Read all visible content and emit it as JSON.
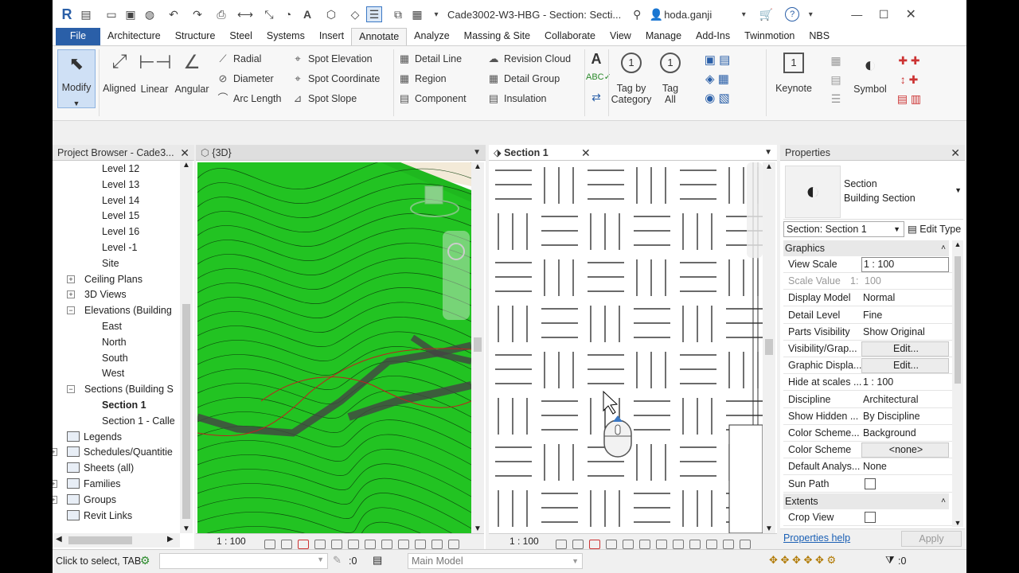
{
  "qat": {
    "title": "Cade3002-W3-HBG - Section: Secti...",
    "user": "hoda.ganji"
  },
  "menu": {
    "tabs": [
      "File",
      "Architecture",
      "Structure",
      "Steel",
      "Systems",
      "Insert",
      "Annotate",
      "Analyze",
      "Massing & Site",
      "Collaborate",
      "View",
      "Manage",
      "Add-Ins",
      "Twinmotion",
      "NBS"
    ],
    "active": "Annotate"
  },
  "ribbon": {
    "modify": "Modify",
    "dims": [
      "Aligned",
      "Linear",
      "Angular"
    ],
    "col1": [
      "Radial",
      "Diameter",
      "Arc  Length"
    ],
    "col2": [
      "Spot  Elevation",
      "Spot  Coordinate",
      "Spot  Slope"
    ],
    "col3": [
      "Detail  Line",
      "Region",
      "Component"
    ],
    "col4": [
      "Revision  Cloud",
      "Detail  Group",
      "Insulation"
    ],
    "tag_by_category": [
      "Tag by",
      "Category"
    ],
    "tag_all": [
      "Tag",
      "All"
    ],
    "keynote": "Keynote",
    "symbol": "Symbol"
  },
  "browser": {
    "title": "Project Browser - Cade3...",
    "items": [
      {
        "label": "Level 12",
        "indent": 3,
        "box": ""
      },
      {
        "label": "Level 13",
        "indent": 3,
        "box": ""
      },
      {
        "label": "Level 14",
        "indent": 3,
        "box": ""
      },
      {
        "label": "Level 15",
        "indent": 3,
        "box": ""
      },
      {
        "label": "Level 16",
        "indent": 3,
        "box": ""
      },
      {
        "label": "Level -1",
        "indent": 3,
        "box": ""
      },
      {
        "label": "Site",
        "indent": 3,
        "box": ""
      },
      {
        "label": "Ceiling Plans",
        "indent": 2,
        "box": "+"
      },
      {
        "label": "3D Views",
        "indent": 2,
        "box": "+"
      },
      {
        "label": "Elevations (Building",
        "indent": 2,
        "box": "−"
      },
      {
        "label": "East",
        "indent": 3,
        "box": ""
      },
      {
        "label": "North",
        "indent": 3,
        "box": ""
      },
      {
        "label": "South",
        "indent": 3,
        "box": ""
      },
      {
        "label": "West",
        "indent": 3,
        "box": ""
      },
      {
        "label": "Sections (Building S",
        "indent": 2,
        "box": "−"
      },
      {
        "label": "Section 1",
        "indent": 3,
        "box": "",
        "bold": true
      },
      {
        "label": "Section 1 - Calle",
        "indent": 3,
        "box": ""
      },
      {
        "label": "Legends",
        "indent": 1,
        "box": ""
      },
      {
        "label": "Schedules/Quantitie",
        "indent": 1,
        "box": "+"
      },
      {
        "label": "Sheets (all)",
        "indent": 1,
        "box": ""
      },
      {
        "label": "Families",
        "indent": 1,
        "box": "+"
      },
      {
        "label": "Groups",
        "indent": 1,
        "box": "+"
      },
      {
        "label": "Revit Links",
        "indent": 1,
        "box": ""
      }
    ]
  },
  "view3d": {
    "tab": "{3D}",
    "scale": "1 : 100"
  },
  "section": {
    "tab": "Section 1",
    "scale": "1 : 100"
  },
  "properties": {
    "title": "Properties",
    "type_line1": "Section",
    "type_line2": "Building Section",
    "selector": "Section: Section 1",
    "edit_type": "Edit Type",
    "group_graphics": "Graphics",
    "rows": [
      {
        "k": "View Scale",
        "v": "1 : 100",
        "style": "input"
      },
      {
        "k": "Scale Value",
        "v": "100",
        "style": "grey",
        "prefix": "1:"
      },
      {
        "k": "Display Model",
        "v": "Normal"
      },
      {
        "k": "Detail Level",
        "v": "Fine"
      },
      {
        "k": "Parts Visibility",
        "v": "Show Original"
      },
      {
        "k": "Visibility/Grap...",
        "v": "Edit...",
        "style": "btn"
      },
      {
        "k": "Graphic Displa...",
        "v": "Edit...",
        "style": "btn"
      },
      {
        "k": "Hide at scales ...",
        "v": "1 : 100"
      },
      {
        "k": "Discipline",
        "v": "Architectural"
      },
      {
        "k": "Show Hidden ...",
        "v": "By Discipline"
      },
      {
        "k": "Color Scheme...",
        "v": "Background"
      },
      {
        "k": "Color Scheme",
        "v": "<none>",
        "style": "btn"
      },
      {
        "k": "Default Analys...",
        "v": "None"
      },
      {
        "k": "Sun Path",
        "v": "",
        "style": "check"
      }
    ],
    "group_extents": "Extents",
    "crop_view": "Crop View",
    "help": "Properties help",
    "apply": "Apply"
  },
  "status": {
    "text": "Click to select, TAB",
    "zero": ":0",
    "model": "Main Model",
    "filter": ":0"
  }
}
